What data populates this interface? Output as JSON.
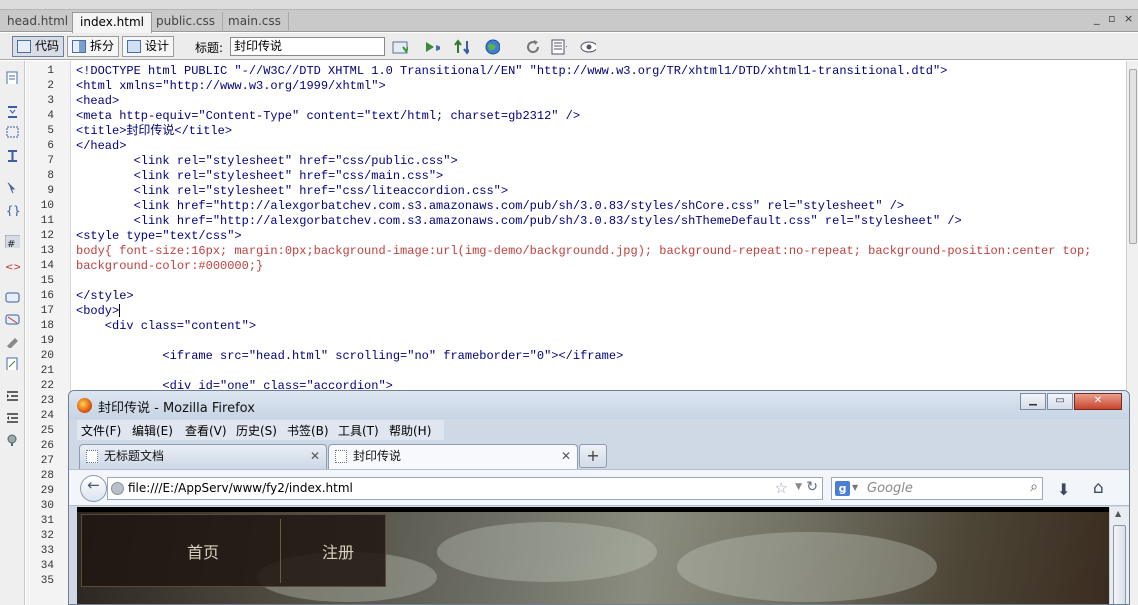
{
  "doc_tabs": [
    "head.html",
    "index.html",
    "public.css",
    "main.css"
  ],
  "active_doc_tab": 1,
  "window_controls": [
    "_",
    "▫",
    "×"
  ],
  "toolbar": {
    "code_label": "代码",
    "split_label": "拆分",
    "design_label": "设计",
    "title_label": "标题:",
    "title_value": "封印传说"
  },
  "line_numbers": [
    "1",
    "2",
    "3",
    "4",
    "5",
    "6",
    "7",
    "8",
    "9",
    "10",
    "11",
    "12",
    "13",
    "14",
    "15",
    "16",
    "17",
    "18",
    "19",
    "20",
    "21",
    "22",
    "23",
    "24",
    "25",
    "26",
    "27",
    "28",
    "29",
    "30",
    "31",
    "32",
    "33",
    "34",
    "35"
  ],
  "code_lines": [
    "<!DOCTYPE html PUBLIC \"-//W3C//DTD XHTML 1.0 Transitional//EN\" \"http://www.w3.org/TR/xhtml1/DTD/xhtml1-transitional.dtd\">",
    "<html xmlns=\"http://www.w3.org/1999/xhtml\">",
    "<head>",
    "<meta http-equiv=\"Content-Type\" content=\"text/html; charset=gb2312\" />",
    "<title>封印传说</title>",
    "</head>",
    "        <link rel=\"stylesheet\" href=\"css/public.css\">",
    "        <link rel=\"stylesheet\" href=\"css/main.css\">",
    "        <link rel=\"stylesheet\" href=\"css/liteaccordion.css\">",
    "        <link href=\"http://alexgorbatchev.com.s3.amazonaws.com/pub/sh/3.0.83/styles/shCore.css\" rel=\"stylesheet\" />",
    "        <link href=\"http://alexgorbatchev.com.s3.amazonaws.com/pub/sh/3.0.83/styles/shThemeDefault.css\" rel=\"stylesheet\" />",
    "<style type=\"text/css\">",
    "body{ font-size:16px; margin:0px;background-image:url(img-demo/backgroundd.jpg); background-repeat:no-repeat; background-position:center top;",
    "background-color:#000000;}",
    "",
    "</style>",
    "<body>",
    "    <div class=\"content\">",
    "",
    "            <iframe src=\"head.html\" scrolling=\"no\" frameborder=\"0\"></iframe>",
    "",
    "            <div id=\"one\" class=\"accordion\">"
  ],
  "firefox": {
    "title": "封印传说 - Mozilla Firefox",
    "menus": [
      "文件(F)",
      "编辑(E)",
      "查看(V)",
      "历史(S)",
      "书签(B)",
      "工具(T)",
      "帮助(H)"
    ],
    "tabs": [
      "无标题文档",
      "封印传说"
    ],
    "active_tab": 1,
    "new_tab_label": "+",
    "url": "file:///E:/AppServ/www/fy2/index.html",
    "search_placeholder": "Google",
    "search_engine_letter": "g",
    "page_nav": [
      "首页",
      "注册"
    ]
  }
}
